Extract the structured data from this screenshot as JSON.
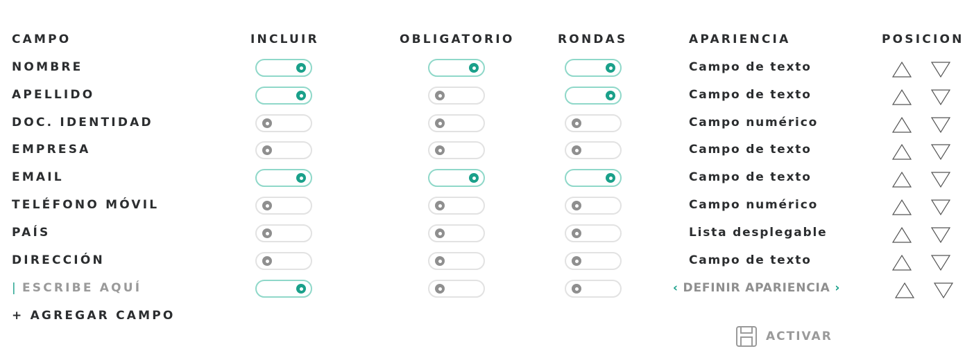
{
  "headers": {
    "campo": "CAMPO",
    "incluir": "INCLUIR",
    "obligatorio": "OBLIGATORIO",
    "rondas": "RONDAS",
    "apariencia": "APARIENCIA",
    "posicion": "POSICION"
  },
  "rows": [
    {
      "label": "NOMBRE",
      "incluir": true,
      "obligatorio": true,
      "rondas": true,
      "apariencia": "Campo de texto"
    },
    {
      "label": "APELLIDO",
      "incluir": true,
      "obligatorio": false,
      "rondas": true,
      "apariencia": "Campo de texto"
    },
    {
      "label": "DOC. IDENTIDAD",
      "incluir": false,
      "obligatorio": false,
      "rondas": false,
      "apariencia": "Campo numérico"
    },
    {
      "label": "EMPRESA",
      "incluir": false,
      "obligatorio": false,
      "rondas": false,
      "apariencia": "Campo de texto"
    },
    {
      "label": "EMAIL",
      "incluir": true,
      "obligatorio": true,
      "rondas": true,
      "apariencia": "Campo de texto"
    },
    {
      "label": "TELÉFONO MÓVIL",
      "incluir": false,
      "obligatorio": false,
      "rondas": false,
      "apariencia": "Campo numérico"
    },
    {
      "label": "PAÍS",
      "incluir": false,
      "obligatorio": false,
      "rondas": false,
      "apariencia": "Lista desplegable"
    },
    {
      "label": "DIRECCIÓN",
      "incluir": false,
      "obligatorio": false,
      "rondas": false,
      "apariencia": "Campo de texto"
    }
  ],
  "new_row": {
    "placeholder": "ESCRIBE AQUÍ",
    "incluir": true,
    "obligatorio": false,
    "rondas": false,
    "define_label": "DEFINIR APARIENCIA"
  },
  "add_field_label": "+ AGREGAR CAMPO",
  "activate_label": "ACTIVAR",
  "colors": {
    "accent": "#1aa08a",
    "accent_border": "#8fd8c9",
    "off_knob": "#8f8f8f",
    "off_border": "#e2e2e2",
    "text": "#2b2d2f",
    "muted": "#9a9a9a"
  }
}
